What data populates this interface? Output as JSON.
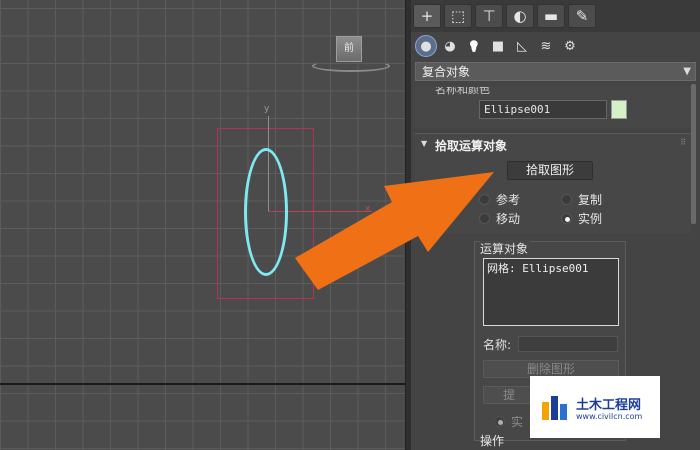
{
  "viewport": {
    "viewcube_face": "前",
    "axis_x": "x",
    "axis_y": "y"
  },
  "panel": {
    "tabs": [
      {
        "icon": "create-plus-icon",
        "glyph": "+"
      },
      {
        "icon": "modify-icon",
        "glyph": "⬚"
      },
      {
        "icon": "hierarchy-icon",
        "glyph": "⊤"
      },
      {
        "icon": "motion-icon",
        "glyph": "◐"
      },
      {
        "icon": "display-icon",
        "glyph": "▬"
      },
      {
        "icon": "utilities-wrench-icon",
        "glyph": "✎"
      }
    ],
    "subtabs": [
      {
        "icon": "geometry-sphere-icon",
        "glyph": "●"
      },
      {
        "icon": "shapes-icon",
        "glyph": "◕"
      },
      {
        "icon": "lights-icon",
        "glyph": "💡"
      },
      {
        "icon": "cameras-icon",
        "glyph": "■"
      },
      {
        "icon": "helpers-icon",
        "glyph": "◺"
      },
      {
        "icon": "spacewarps-icon",
        "glyph": "≋"
      },
      {
        "icon": "systems-icon",
        "glyph": "⚙"
      }
    ],
    "category": "复合对象",
    "name_color": {
      "header_cutoff": "名称和颜色",
      "object_name": "Ellipse001",
      "swatch_color": "#d5f1c7"
    },
    "pick_operand": {
      "title": "拾取运算对象",
      "pick_button": "拾取图形",
      "radio_reference": "参考",
      "radio_copy": "复制",
      "radio_move": "移动",
      "radio_instance": "实例"
    },
    "operands": {
      "group_label": "运算对象",
      "list_items": [
        "网格: Ellipse001"
      ],
      "name_label": "名称:",
      "delete_button": "删除图形",
      "extract_button": "提",
      "instance_label": "实",
      "operation_label": "操作"
    }
  },
  "watermark": {
    "title": "土木工程网",
    "url": "www.civilcn.com"
  },
  "colors": {
    "arrow": "#f07016",
    "ellipse": "#7fe9ef",
    "bbox": "#b83154"
  }
}
